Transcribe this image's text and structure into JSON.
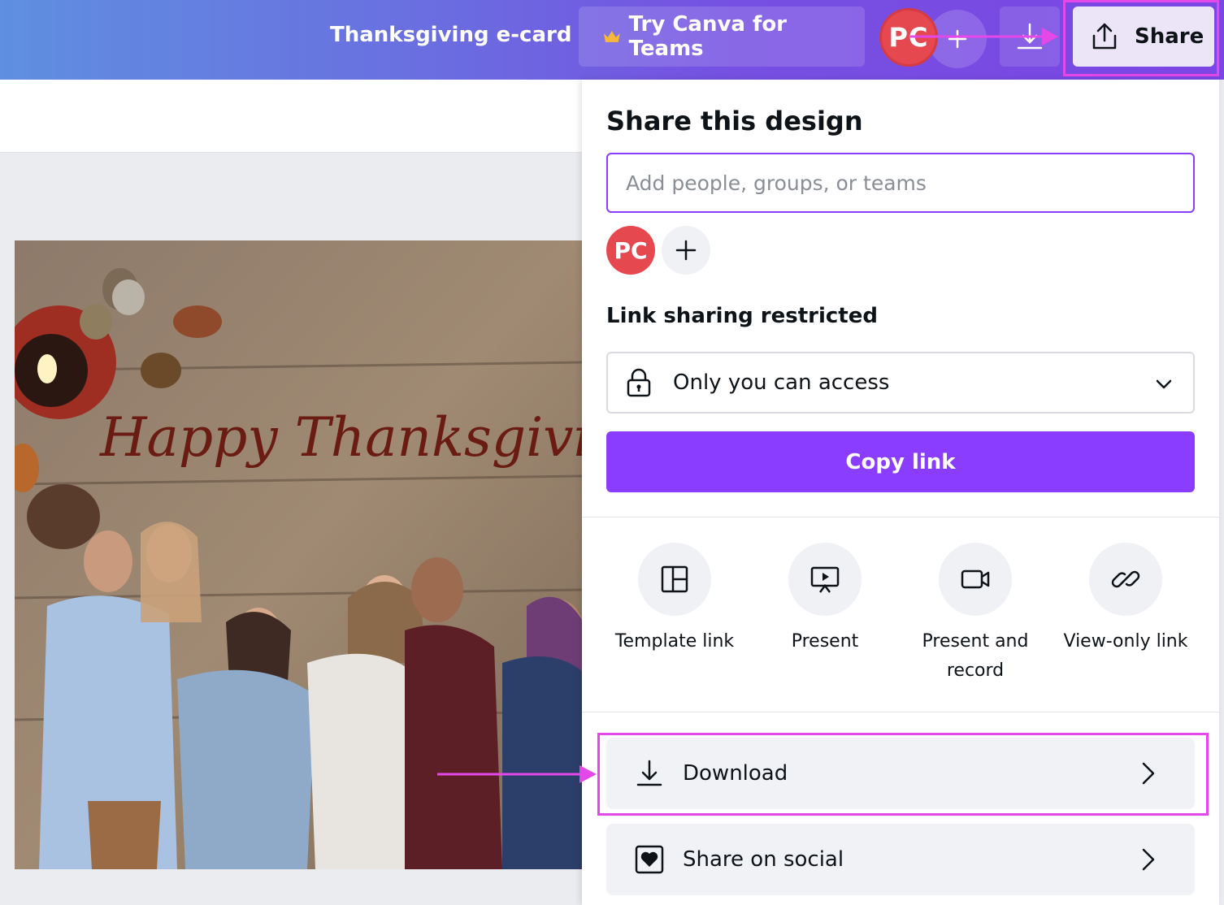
{
  "topbar": {
    "doc_title": "Thanksgiving e-card",
    "teams_label": "Try Canva for Teams",
    "avatar_initials": "PC",
    "share_label": "Share"
  },
  "canvas": {
    "card_text": "Happy Thanksgiving"
  },
  "share_panel": {
    "title": "Share this design",
    "people_placeholder": "Add people, groups, or teams",
    "member_initials": "PC",
    "link_sharing_label": "Link sharing restricted",
    "access_value": "Only you can access",
    "copy_link_label": "Copy link",
    "options": [
      {
        "label": "Template link",
        "icon": "template-icon"
      },
      {
        "label": "Present",
        "icon": "present-icon"
      },
      {
        "label": "Present and record",
        "icon": "camera-icon"
      },
      {
        "label": "View-only link",
        "icon": "link-icon"
      }
    ],
    "download_label": "Download",
    "share_social_label": "Share on social"
  },
  "colors": {
    "accent": "#8b3dff",
    "highlight": "#e548e8",
    "avatar": "#e5484f"
  }
}
